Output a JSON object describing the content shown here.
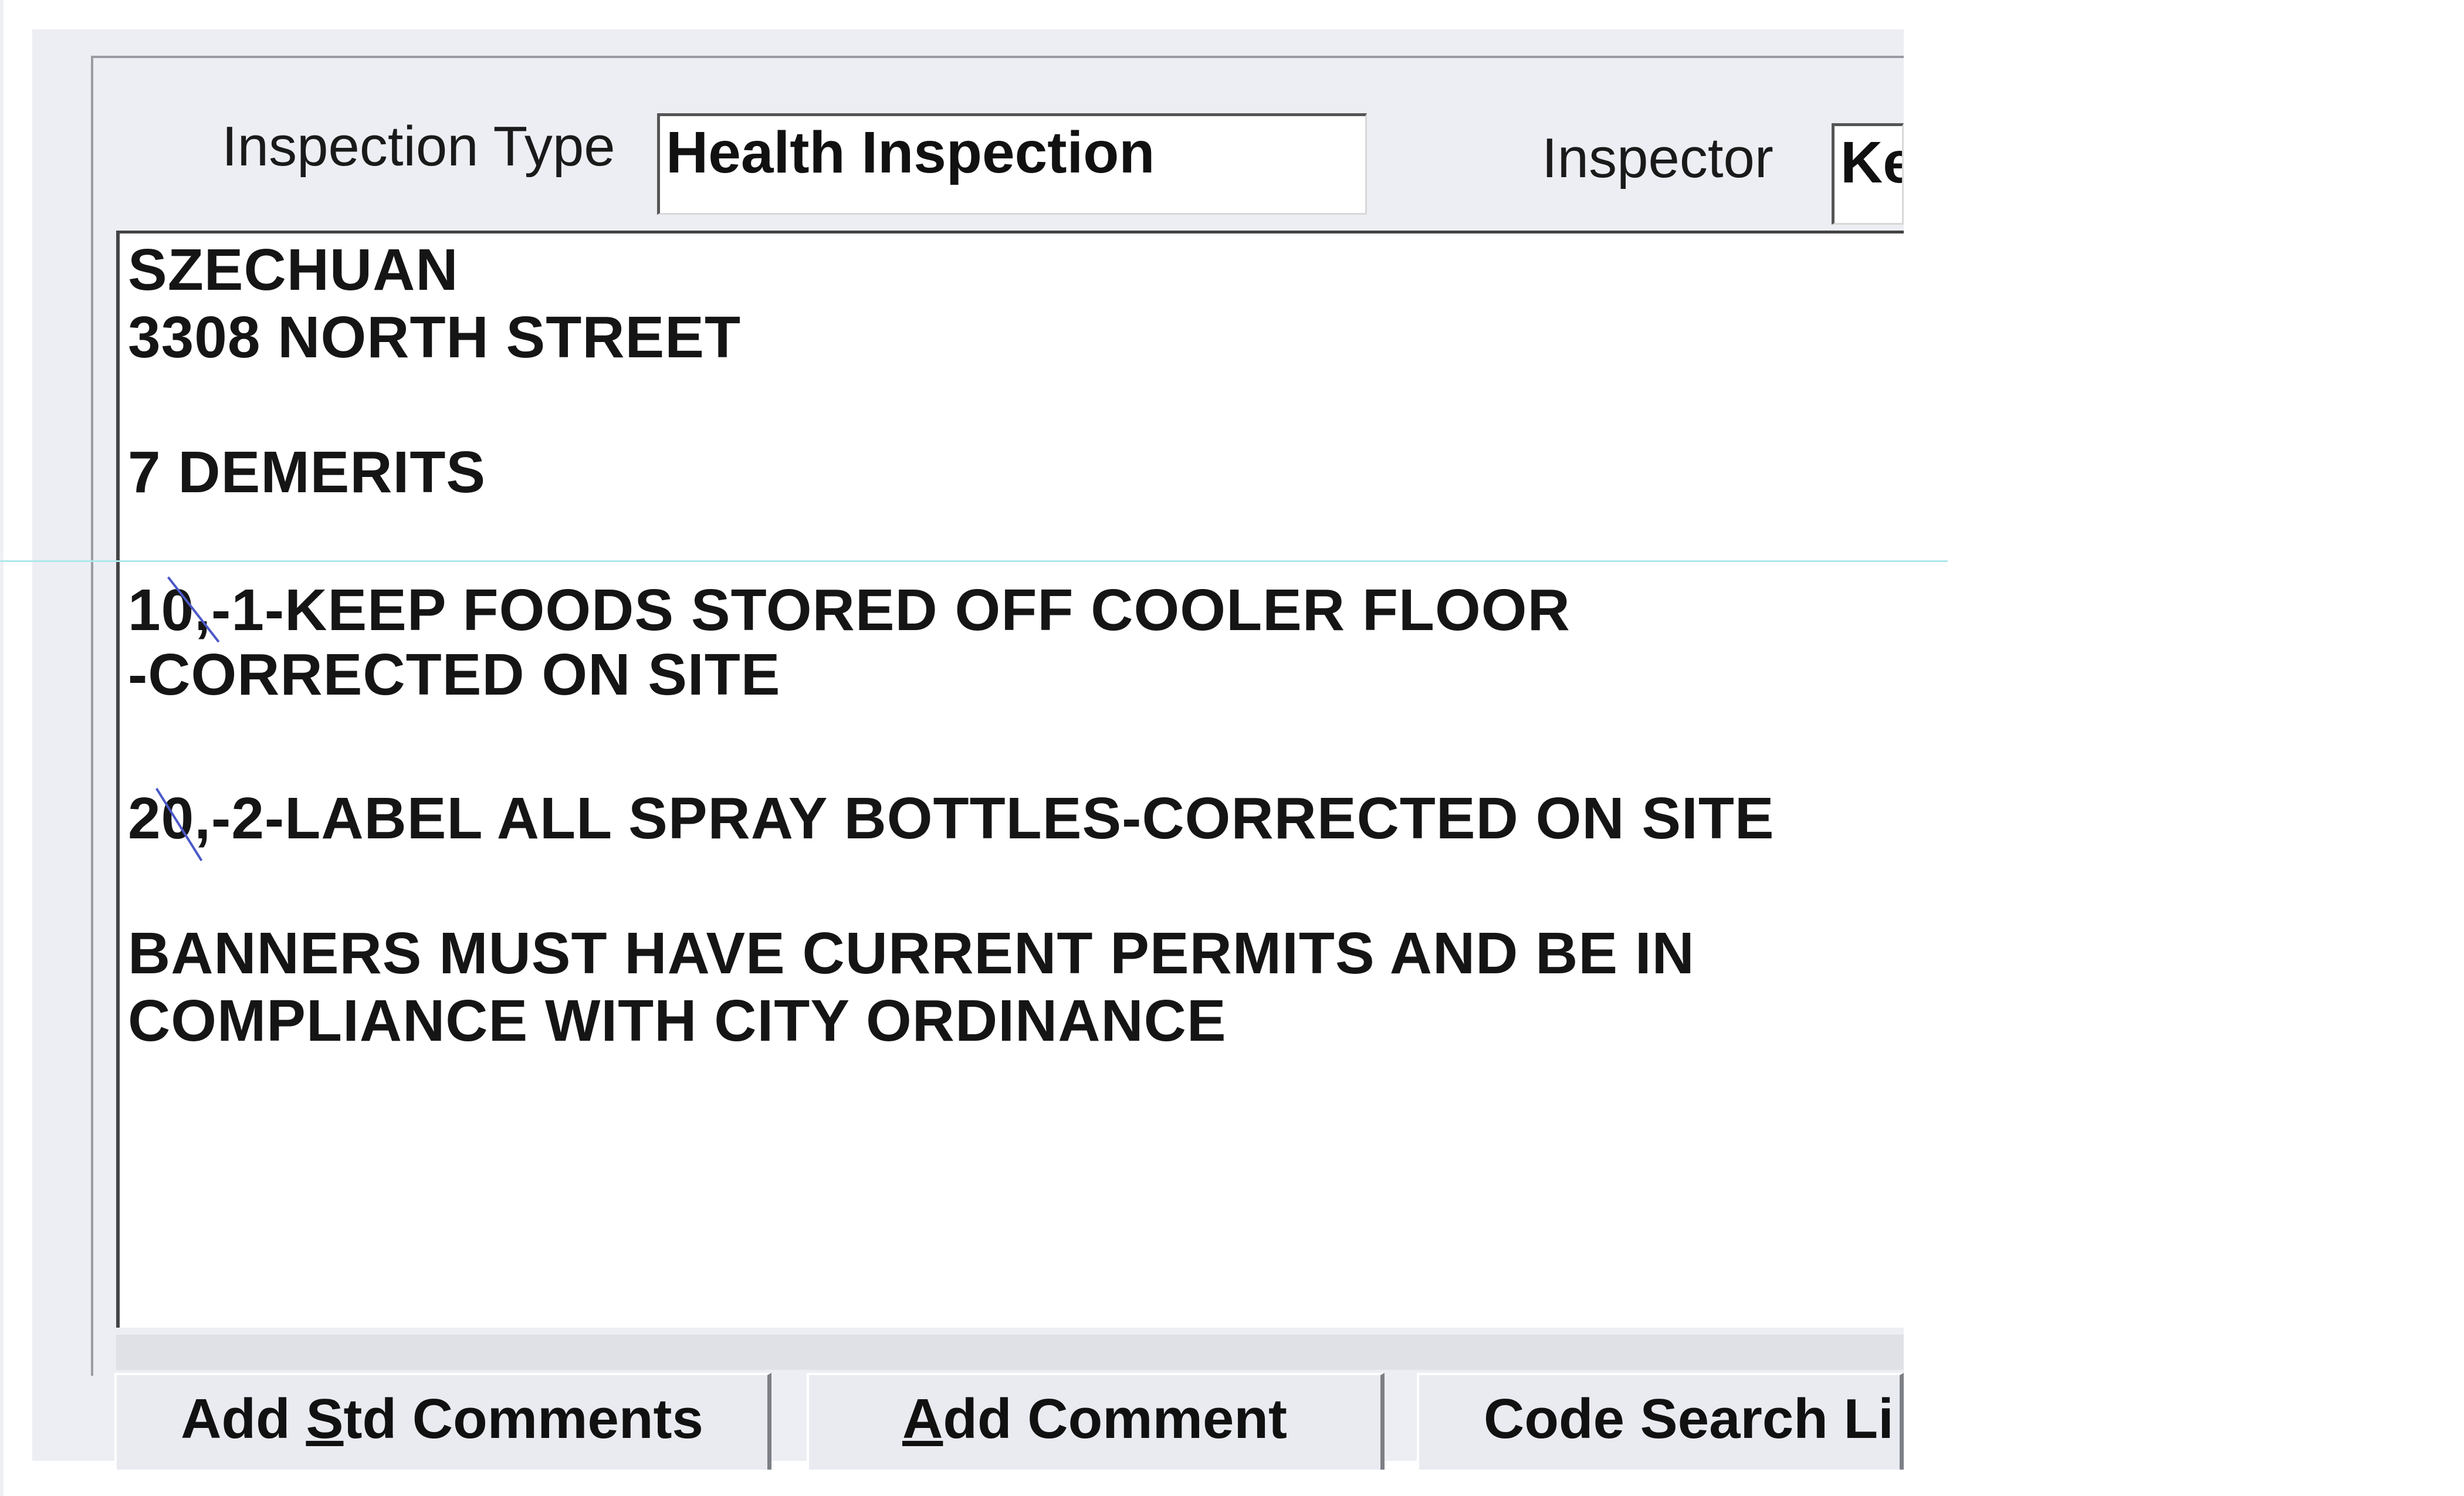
{
  "form": {
    "inspection_type_label": "Inspection Type",
    "inspection_type_value": "Health Inspection",
    "inspector_label": "Inspector",
    "inspector_value": "Ke"
  },
  "comments": {
    "lines": [
      "SZECHUAN",
      "3308 NORTH STREET",
      "7 DEMERITS",
      "10,-1-KEEP FOODS STORED OFF COOLER FLOOR",
      "-CORRECTED ON SITE",
      "20,-2-LABEL ALL SPRAY BOTTLES-CORRECTED ON SITE",
      "BANNERS MUST HAVE CURRENT PERMITS AND BE IN",
      "COMPLIANCE WITH  CITY ORDINANCE"
    ]
  },
  "buttons": {
    "add_std_comments_prefix": "Add ",
    "add_std_comments_mnemonic": "S",
    "add_std_comments_suffix": "td Comments",
    "add_comment_mnemonic": "A",
    "add_comment_suffix": "dd Comment",
    "code_search_label": "Code Search Li"
  },
  "colors": {
    "window_background": "#eceef3",
    "field_background": "#ffffff",
    "pen_mark": "#4b58c8"
  }
}
